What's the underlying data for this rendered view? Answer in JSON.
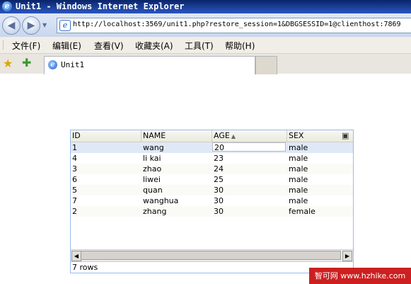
{
  "window": {
    "title": "Unit1 - Windows Internet Explorer"
  },
  "address": {
    "url": "http://localhost:3569/unit1.php?restore_session=1&DBGSESSID=1@clienthost:7869"
  },
  "menu": {
    "items": [
      "文件(F)",
      "编辑(E)",
      "查看(V)",
      "收藏夹(A)",
      "工具(T)",
      "帮助(H)"
    ]
  },
  "tabs": [
    {
      "label": "Unit1"
    }
  ],
  "grid": {
    "columns": [
      "ID",
      "NAME",
      "AGE",
      "SEX"
    ],
    "sort": {
      "column": "AGE",
      "direction": "ascending"
    },
    "rows": [
      {
        "id": "1",
        "name": "wang",
        "age": "20",
        "sex": "male"
      },
      {
        "id": "4",
        "name": "li kai",
        "age": "23",
        "sex": "male"
      },
      {
        "id": "3",
        "name": "zhao",
        "age": "24",
        "sex": "male"
      },
      {
        "id": "6",
        "name": "liwei",
        "age": "25",
        "sex": "male"
      },
      {
        "id": "5",
        "name": "quan",
        "age": "30",
        "sex": "male"
      },
      {
        "id": "7",
        "name": "wanghua",
        "age": "30",
        "sex": "male"
      },
      {
        "id": "2",
        "name": "zhang",
        "age": "30",
        "sex": "female"
      }
    ],
    "status": "7 rows"
  },
  "watermark": {
    "text": "智可网 www.hzhike.com"
  },
  "icons": {
    "back": "back-arrow-icon",
    "forward": "forward-arrow-icon",
    "favorites": "star-icon",
    "add_favorite": "add-favorite-icon"
  }
}
